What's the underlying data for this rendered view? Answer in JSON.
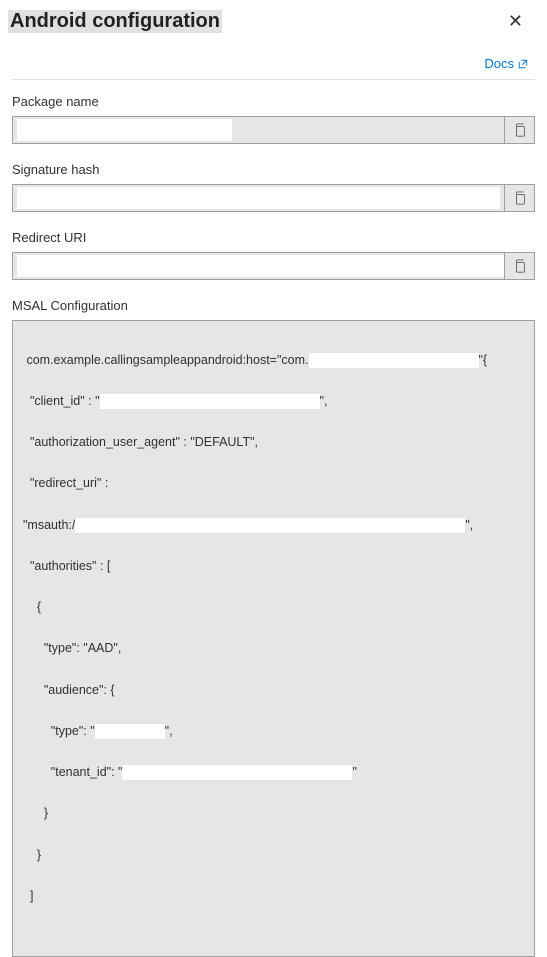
{
  "header": {
    "title": "Android configuration"
  },
  "links": {
    "docs": "Docs"
  },
  "fields": {
    "package": {
      "label": "Package name"
    },
    "signature": {
      "label": "Signature hash"
    },
    "redirect": {
      "label": "Redirect URI"
    },
    "msal": {
      "label": "MSAL Configuration"
    }
  },
  "msal": {
    "line1_prefix": " com.example.callingsampleappandroid:host=\"com.",
    "line1_suffix": "\"{",
    "line2_prefix": "  \"client_id\" : \"",
    "line2_suffix": "\",",
    "line3": "  \"authorization_user_agent\" : \"DEFAULT\",",
    "line4": "  \"redirect_uri\" :",
    "line5_prefix": "\"msauth:/",
    "line5_suffix": "\",",
    "line6": "  \"authorities\" : [",
    "line7": "    {",
    "line8": "      \"type\": \"AAD\",",
    "line9": "      \"audience\": {",
    "line10_prefix": "        \"type\": \"",
    "line10_suffix": "\",",
    "line11_prefix": "        \"tenant_id\": \"",
    "line11_suffix": "\"",
    "line12": "      }",
    "line13": "    }",
    "line14": "  ]"
  }
}
